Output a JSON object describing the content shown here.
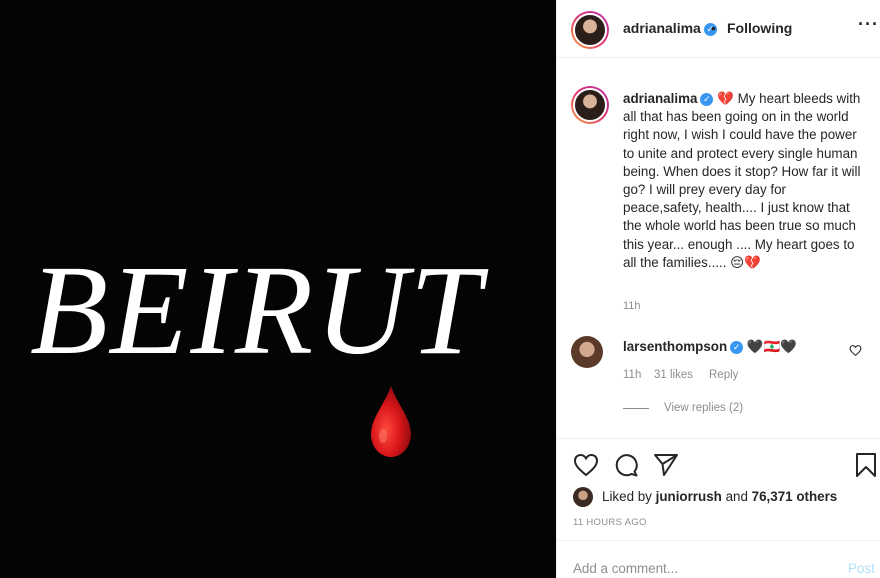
{
  "image": {
    "headline": "BEIRUT",
    "drop_icon": "blood-drop-icon",
    "background": "#050404",
    "drop_color": "#d8161b"
  },
  "header": {
    "username": "adrianalima",
    "separator": "•",
    "follow_status": "Following",
    "more_icon": "more-horizontal-icon"
  },
  "caption": {
    "username": "adrianalima",
    "text": "💔 My heart bleeds with all that has been going on in the world right now, I wish I could have the power to unite and protect every single human being. When does it stop? How far it will go? I will prey every day for peace,safety, health.... I just know that the whole world has been true so much this year... enough .... My heart goes to all the families..... 😔💔",
    "time": "11h"
  },
  "comments": [
    {
      "username": "larsenthompson",
      "text": "🖤🇱🇧🖤",
      "time": "11h",
      "likes": "31 likes",
      "reply_label": "Reply",
      "view_replies": "View replies (2)"
    }
  ],
  "likes": {
    "prefix": "Liked by",
    "liker": "juniorrush",
    "connector": "and",
    "others": "76,371 others"
  },
  "post_time": "11 HOURS AGO",
  "comment_box": {
    "placeholder": "Add a comment...",
    "post_label": "Post"
  },
  "colors": {
    "verified": "#3897f0",
    "secondary_text": "#8e8e8e",
    "post_disabled": "#b2dffc"
  }
}
